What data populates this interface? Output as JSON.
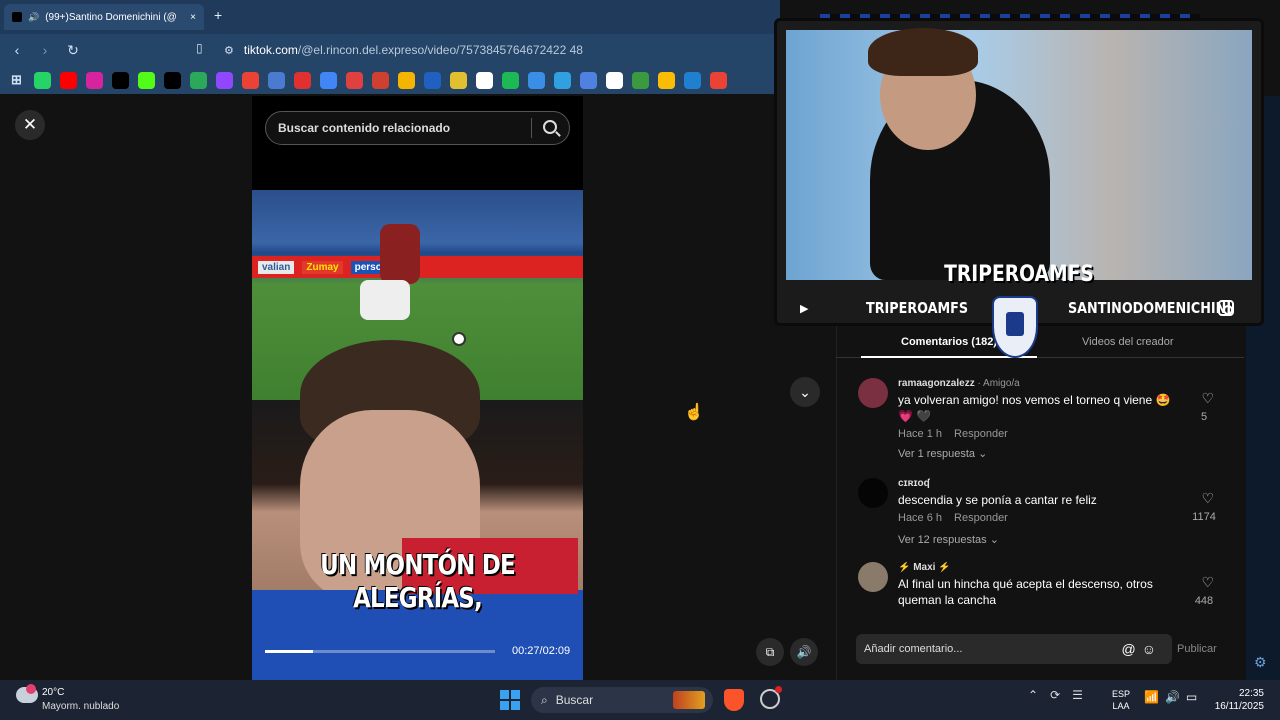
{
  "browser": {
    "tab_title": "(99+)Santino Domenichini (@",
    "new_tab": "+",
    "tab_close": "×",
    "url_domain": "tiktok.com",
    "url_path": "/@el.rincon.del.expreso/video/7573845764672422 48",
    "bookmarks": [
      {
        "name": "whatsapp-icon",
        "color": "#25d366"
      },
      {
        "name": "youtube-icon",
        "color": "#ff0000"
      },
      {
        "name": "instagram-icon",
        "color": "#d6249f"
      },
      {
        "name": "tiktok-icon",
        "color": "#000000"
      },
      {
        "name": "kick-icon",
        "color": "#53fc18"
      },
      {
        "name": "x-icon",
        "color": "#000000"
      },
      {
        "name": "app-icon-1",
        "color": "#2ca85a"
      },
      {
        "name": "twitch-icon",
        "color": "#9146ff"
      },
      {
        "name": "google-icon",
        "color": "#ea4335"
      },
      {
        "name": "app-icon-2",
        "color": "#4a7bd0"
      },
      {
        "name": "app-icon-3",
        "color": "#e03030"
      },
      {
        "name": "docs-icon",
        "color": "#4285f4"
      },
      {
        "name": "app-icon-4",
        "color": "#e04040"
      },
      {
        "name": "app-icon-5",
        "color": "#d04030"
      },
      {
        "name": "app-icon-6",
        "color": "#f4b400"
      },
      {
        "name": "app-icon-7",
        "color": "#2060c0"
      },
      {
        "name": "app-icon-8",
        "color": "#e0c030"
      },
      {
        "name": "app-icon-9",
        "color": "#ffffff"
      },
      {
        "name": "spotify-icon",
        "color": "#1db954"
      },
      {
        "name": "download-icon",
        "color": "#3a8ee6"
      },
      {
        "name": "app-icon-10",
        "color": "#30a0e0"
      },
      {
        "name": "app-icon-11",
        "color": "#5080e0"
      },
      {
        "name": "app-icon-12",
        "color": "#ffffff"
      },
      {
        "name": "app-icon-13",
        "color": "#3a9a40"
      },
      {
        "name": "drive-icon",
        "color": "#fbbc04"
      },
      {
        "name": "app-icon-14",
        "color": "#2080d0"
      },
      {
        "name": "google-icon-2",
        "color": "#ea4335"
      }
    ]
  },
  "video": {
    "search_placeholder": "Buscar contenido relacionado",
    "caption": "UN MONTÓN DE ALEGRÍAS,",
    "time": "00:27/02:09",
    "progress": 0.21,
    "ads": [
      "valian",
      "Zumay",
      "personal"
    ]
  },
  "stream": {
    "name": "TRIPEROAMFS",
    "youtube_name": "TRIPEROAMFS",
    "instagram_name": "SANTINODOMENICHINI"
  },
  "comments_panel": {
    "tab_comments": "Comentarios (182)",
    "tab_videos": "Videos del creador",
    "comments": [
      {
        "user": "ramaagonzalezz",
        "tag": " · Amigo/a",
        "text": "ya volveran amigo! nos vemos el torneo q viene 🤩 💗 🖤",
        "time": "Hace 1 h",
        "reply": "Responder",
        "replies": "Ver 1 respuesta ⌄",
        "likes": "5",
        "avatar_color": "#7a3040"
      },
      {
        "user": "cɪʀɪoʠ",
        "tag": "",
        "text": "descendia y se ponía a cantar re feliz",
        "time": "Hace 6 h",
        "reply": "Responder",
        "replies": "Ver 12 respuestas ⌄",
        "likes": "1174",
        "avatar_color": "#050505"
      },
      {
        "user": "⚡ Maxi ⚡",
        "tag": "",
        "text": "Al final un hincha qué acepta el descenso, otros queman la cancha",
        "time": "",
        "reply": "",
        "replies": "",
        "likes": "448",
        "avatar_color": "#8a7a6a"
      }
    ],
    "add_comment": "Añadir comentario...",
    "publish": "Publicar"
  },
  "taskbar": {
    "temp": "20°C",
    "weather": "Mayorm. nublado",
    "search": "Buscar",
    "lang1": "ESP",
    "lang2": "LAA",
    "time": "22:35",
    "date": "16/11/2025"
  }
}
